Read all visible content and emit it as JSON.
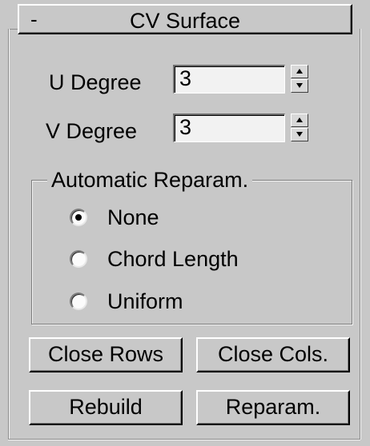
{
  "rollout": {
    "collapse_symbol": "-",
    "title": "CV Surface"
  },
  "params": {
    "u_degree": {
      "label": "U Degree",
      "value": "3"
    },
    "v_degree": {
      "label": "V Degree",
      "value": "3"
    }
  },
  "reparam_group": {
    "legend": "Automatic Reparam.",
    "options": [
      {
        "label": "None",
        "selected": true
      },
      {
        "label": "Chord Length",
        "selected": false
      },
      {
        "label": "Uniform",
        "selected": false
      }
    ]
  },
  "buttons": {
    "close_rows": "Close Rows",
    "close_cols": "Close Cols.",
    "rebuild": "Rebuild",
    "reparam": "Reparam."
  }
}
